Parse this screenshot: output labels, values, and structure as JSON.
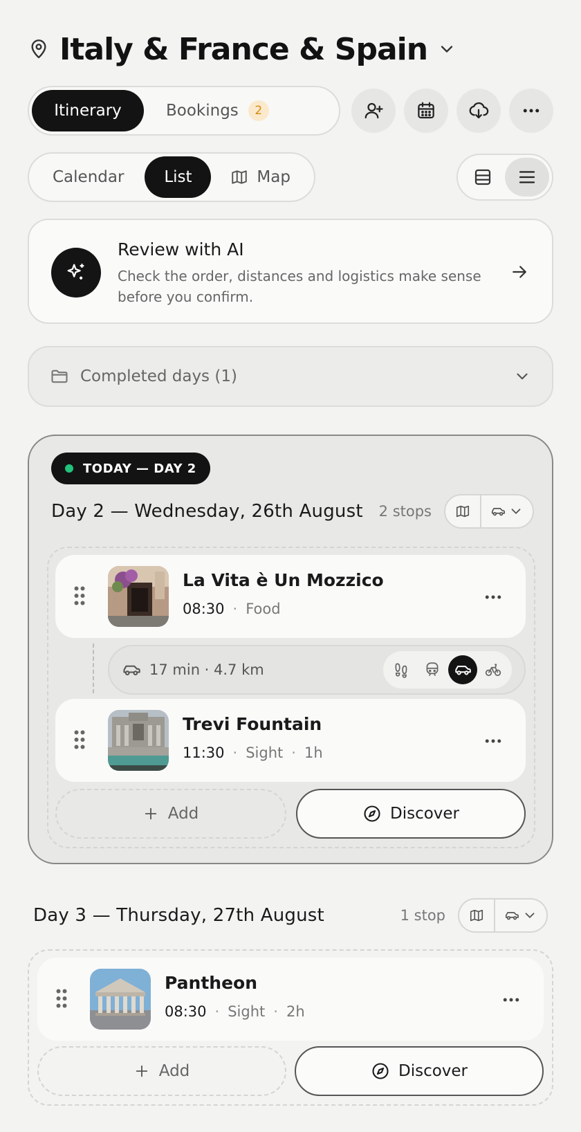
{
  "header": {
    "title": "Italy & France & Spain"
  },
  "tabs": {
    "items": [
      {
        "label": "Itinerary",
        "active": true
      },
      {
        "label": "Bookings",
        "badge": "2",
        "active": false
      }
    ]
  },
  "actions": [
    "add-person-icon",
    "calendar-icon",
    "download-cloud-icon",
    "more-icon"
  ],
  "view_tabs": {
    "items": [
      {
        "label": "Calendar",
        "active": false
      },
      {
        "label": "List",
        "active": true
      },
      {
        "label": "Map",
        "active": false
      }
    ]
  },
  "density_toggle": {
    "options": [
      "card-view-icon",
      "compact-list-icon"
    ],
    "selected": "compact-list-icon"
  },
  "review": {
    "title": "Review with AI",
    "description": "Check the order, distances and logistics make sense before you confirm."
  },
  "completed": {
    "label": "Completed days (1)"
  },
  "today": {
    "badge": "TODAY — DAY 2",
    "day_title": "Day 2 — Wednesday, 26th August",
    "stops_label": "2 stops",
    "stops": [
      {
        "name": "La Vita è Un Mozzico",
        "time": "08:30",
        "category": "Food",
        "duration": ""
      },
      {
        "name": "Trevi Fountain",
        "time": "11:30",
        "category": "Sight",
        "duration": "1h"
      }
    ],
    "travel": {
      "text": "17 min · 4.7 km",
      "modes": [
        "walk",
        "transit",
        "car",
        "bike"
      ],
      "selected": "car"
    },
    "add_label": "Add",
    "discover_label": "Discover"
  },
  "day3": {
    "day_title": "Day 3 — Thursday, 27th August",
    "stops_label": "1 stop",
    "stops": [
      {
        "name": "Pantheon",
        "time": "08:30",
        "category": "Sight",
        "duration": "2h"
      }
    ],
    "add_label": "Add",
    "discover_label": "Discover"
  },
  "colors": {
    "accent_dark": "#131313",
    "today_dot": "#22c27a",
    "badge_bg": "#fbe9cc",
    "badge_fg": "#d48a10"
  }
}
